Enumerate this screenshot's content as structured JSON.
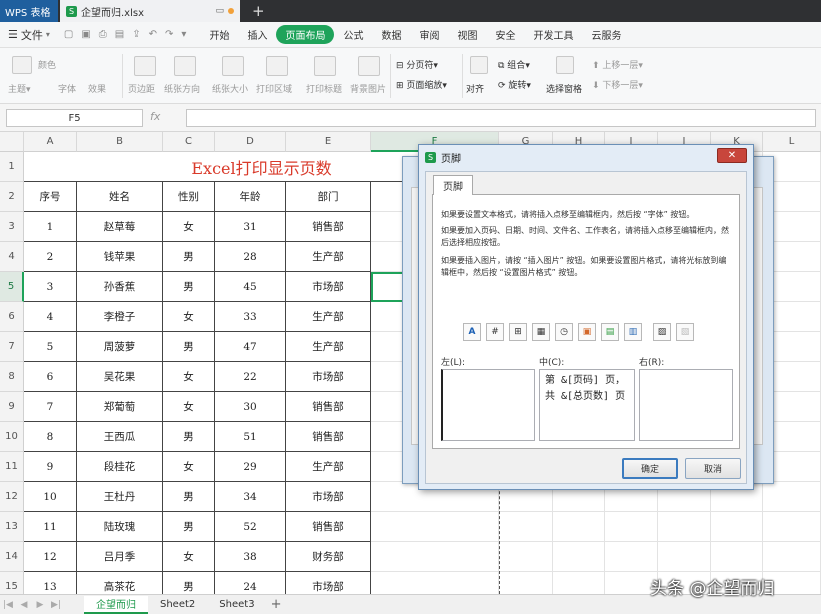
{
  "app": {
    "name": "WPS 表格"
  },
  "document": {
    "tab_title": "企望而归.xlsx"
  },
  "menu": {
    "file": "文件",
    "tabs": [
      "开始",
      "插入",
      "页面布局",
      "公式",
      "数据",
      "审阅",
      "视图",
      "安全",
      "开发工具",
      "云服务"
    ],
    "active_tab": "页面布局"
  },
  "ribbon": {
    "theme_items": [
      "颜色",
      "字体",
      "效果"
    ],
    "items": [
      "页边距",
      "纸张方向",
      "纸张大小",
      "打印区域",
      "打印标题",
      "背景图片"
    ],
    "page_break": "分页符",
    "page_zoom": "页面缩放",
    "align": "对齐",
    "group": "组合",
    "rotate": "旋转",
    "select_pane": "选择窗格",
    "bring_forward": "上移一层",
    "send_backward": "下移一层"
  },
  "formula_bar": {
    "name_box": "F5",
    "fx": "fx",
    "value": ""
  },
  "grid": {
    "columns": [
      "A",
      "B",
      "C",
      "D",
      "E",
      "F",
      "G",
      "H",
      "I",
      "J",
      "K",
      "L"
    ],
    "selected_col": "F",
    "selected_row": "5",
    "row_numbers": [
      "1",
      "2",
      "3",
      "4",
      "5",
      "6",
      "7",
      "8",
      "9",
      "10",
      "11",
      "12",
      "13",
      "14",
      "15"
    ],
    "title": "Excel打印显示页数",
    "headers": [
      "序号",
      "姓名",
      "性别",
      "年龄",
      "部门"
    ],
    "rows": [
      [
        "1",
        "赵草莓",
        "女",
        "31",
        "销售部"
      ],
      [
        "2",
        "钱苹果",
        "男",
        "28",
        "生产部"
      ],
      [
        "3",
        "孙香蕉",
        "男",
        "45",
        "市场部"
      ],
      [
        "4",
        "李橙子",
        "女",
        "33",
        "生产部"
      ],
      [
        "5",
        "周菠萝",
        "男",
        "47",
        "生产部"
      ],
      [
        "6",
        "吴花果",
        "女",
        "22",
        "市场部"
      ],
      [
        "7",
        "郑葡萄",
        "女",
        "30",
        "销售部"
      ],
      [
        "8",
        "王西瓜",
        "男",
        "51",
        "销售部"
      ],
      [
        "9",
        "段桂花",
        "女",
        "29",
        "生产部"
      ],
      [
        "10",
        "王杜丹",
        "男",
        "34",
        "市场部"
      ],
      [
        "11",
        "陆玫瑰",
        "男",
        "52",
        "销售部"
      ],
      [
        "12",
        "吕月季",
        "女",
        "38",
        "财务部"
      ],
      [
        "13",
        "高茶花",
        "男",
        "24",
        "市场部"
      ]
    ]
  },
  "sheets": {
    "tabs": [
      "企望而归",
      "Sheet2",
      "Sheet3"
    ],
    "active": "企望而归"
  },
  "watermark": "头条 @企望而归",
  "dialog": {
    "title": "页脚",
    "tab": "页脚",
    "instructions": [
      "如果要设置文本格式，请将插入点移至编辑框内，然后按 “字体” 按钮。",
      "如果要加入页码、日期、时间、文件名、工作表名，请将插入点移至编辑框内，然后选择相应按钮。",
      "如果要插入图片，请按 “插入图片” 按钮。如果要设置图片格式，请将光标放到编辑框中，然后按 “设置图片格式” 按钮。"
    ],
    "toolbar_icons": [
      "font-icon",
      "page-number-icon",
      "total-pages-icon",
      "date-icon",
      "time-icon",
      "file-path-icon",
      "file-name-icon",
      "sheet-name-icon",
      "insert-picture-icon",
      "format-picture-icon"
    ],
    "left_label": "左(L):",
    "center_label": "中(C):",
    "right_label": "右(R):",
    "left_value": "",
    "center_value": "第 &[页码] 页，\n共 &[总页数] 页",
    "right_value": "",
    "ok": "确定",
    "cancel": "取消"
  }
}
